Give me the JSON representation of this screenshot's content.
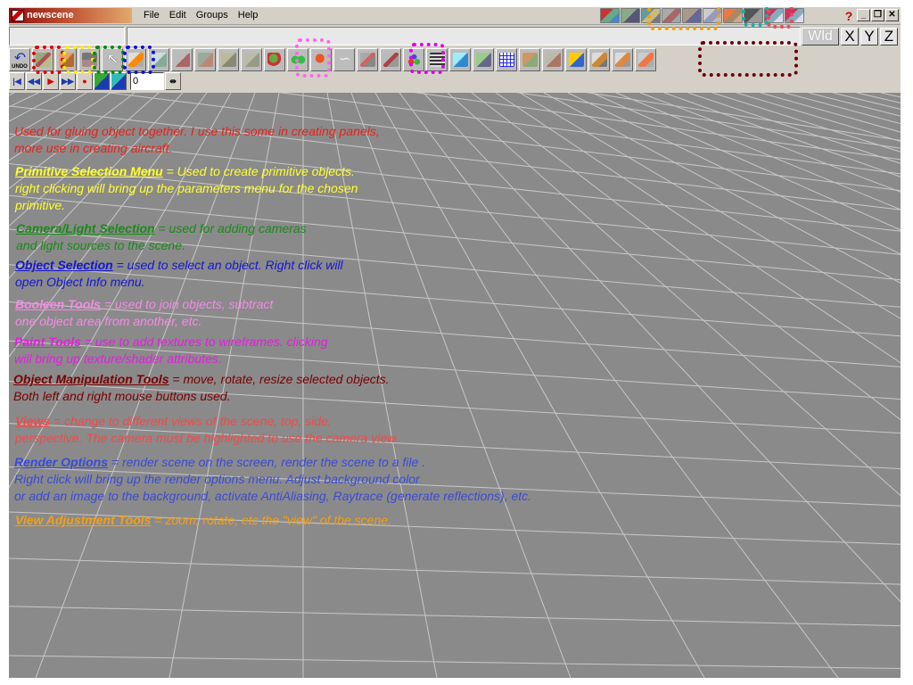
{
  "app": {
    "title": "newscene"
  },
  "menu": [
    {
      "label": "File"
    },
    {
      "label": "Edit"
    },
    {
      "label": "Groups"
    },
    {
      "label": "Help"
    }
  ],
  "window_controls": {
    "minimize": "_",
    "restore": "❐",
    "close": "✕"
  },
  "help_glyph": "?",
  "view_buttons": [
    {
      "label": "Wld"
    },
    {
      "label": "X"
    },
    {
      "label": "Y"
    },
    {
      "label": "Z"
    }
  ],
  "undo_label": "UNDO",
  "frame_value": "0",
  "anim_controls": [
    {
      "icon": "skip-to-start-icon",
      "glyph": "|◀"
    },
    {
      "icon": "rewind-icon",
      "glyph": "◀◀"
    },
    {
      "icon": "play-icon",
      "glyph": "▶"
    },
    {
      "icon": "fast-forward-icon",
      "glyph": "▶▶"
    },
    {
      "icon": "record-icon",
      "glyph": "●"
    }
  ],
  "annotations": [
    {
      "name": "glue-tool-annotation",
      "heading": "",
      "text": "Used for gluing object together.  I use this some in creating panels,\nmore use in creating aircraft.",
      "color": "#e8231c"
    },
    {
      "name": "primitive-selection-annotation",
      "heading": "Primitive Selection Menu",
      "text": " = Used to create primitive objects.\nright clicking will bring up the parameters menu for the chosen\nprimitive.",
      "color": "#ffff33"
    },
    {
      "name": "camera-light-annotation",
      "heading": "Camera/Light Selection",
      "text": " = used for adding cameras\nand light sources to the scene.",
      "color": "#1a8a1a"
    },
    {
      "name": "object-selection-annotation",
      "heading": "Object Selection",
      "text": " = used to select an object.  Right click will\nopen Object Info menu.",
      "color": "#1616d4"
    },
    {
      "name": "boolean-tools-annotation",
      "heading": "Booleen Tools",
      "text": " = used to join objects, subtract\none object area from another, etc.",
      "color": "#f58ae6"
    },
    {
      "name": "paint-tools-annotation",
      "heading": "Paint Tools",
      "text": " = use to add textures to wireframes.  clicking\nwill bring up texture/shader attributes.",
      "color": "#e41ee0"
    },
    {
      "name": "object-manipulation-annotation",
      "heading": "Object Manipulation Tools",
      "text": " = move, rotate, resize selected objects.\nBoth left and right mouse buttons used.",
      "color": "#7a0000"
    },
    {
      "name": "views-annotation",
      "heading": "Views",
      "text": " = change to different views of the scene, top, side,\nperspective.  The camera must be highlighted to use the camera view.",
      "color": "#f04a4a"
    },
    {
      "name": "render-options-annotation",
      "heading": "Render Options",
      "text": " = render scene on the screen, render the scene to a file .\nRight click will bring up the render options menu.  Adjust background color\nor add an image to the background, activate AntiAliasing, Raytrace (generate reflections), etc.",
      "color": "#3a4bd8"
    },
    {
      "name": "view-adjustment-annotation",
      "heading": "View Adjustment Tools",
      "text": " = zoom, rotate, etc the \"view\" of the scene.",
      "color": "#f2a014"
    }
  ],
  "colors": {
    "viewport_bg": "#8a8a8a",
    "grid_line": "#c8c8c8",
    "ring_red": "#e00000",
    "ring_yellow": "#ffee00",
    "ring_green": "#0a8a0a",
    "ring_blue": "#1010dd",
    "ring_pink": "#ff66ee",
    "ring_magenta": "#e000e0",
    "ring_maroon": "#6a0000",
    "ring_orange": "#f0a010",
    "ring_teal": "#10b0b0",
    "ring_coral": "#f04a4a"
  }
}
